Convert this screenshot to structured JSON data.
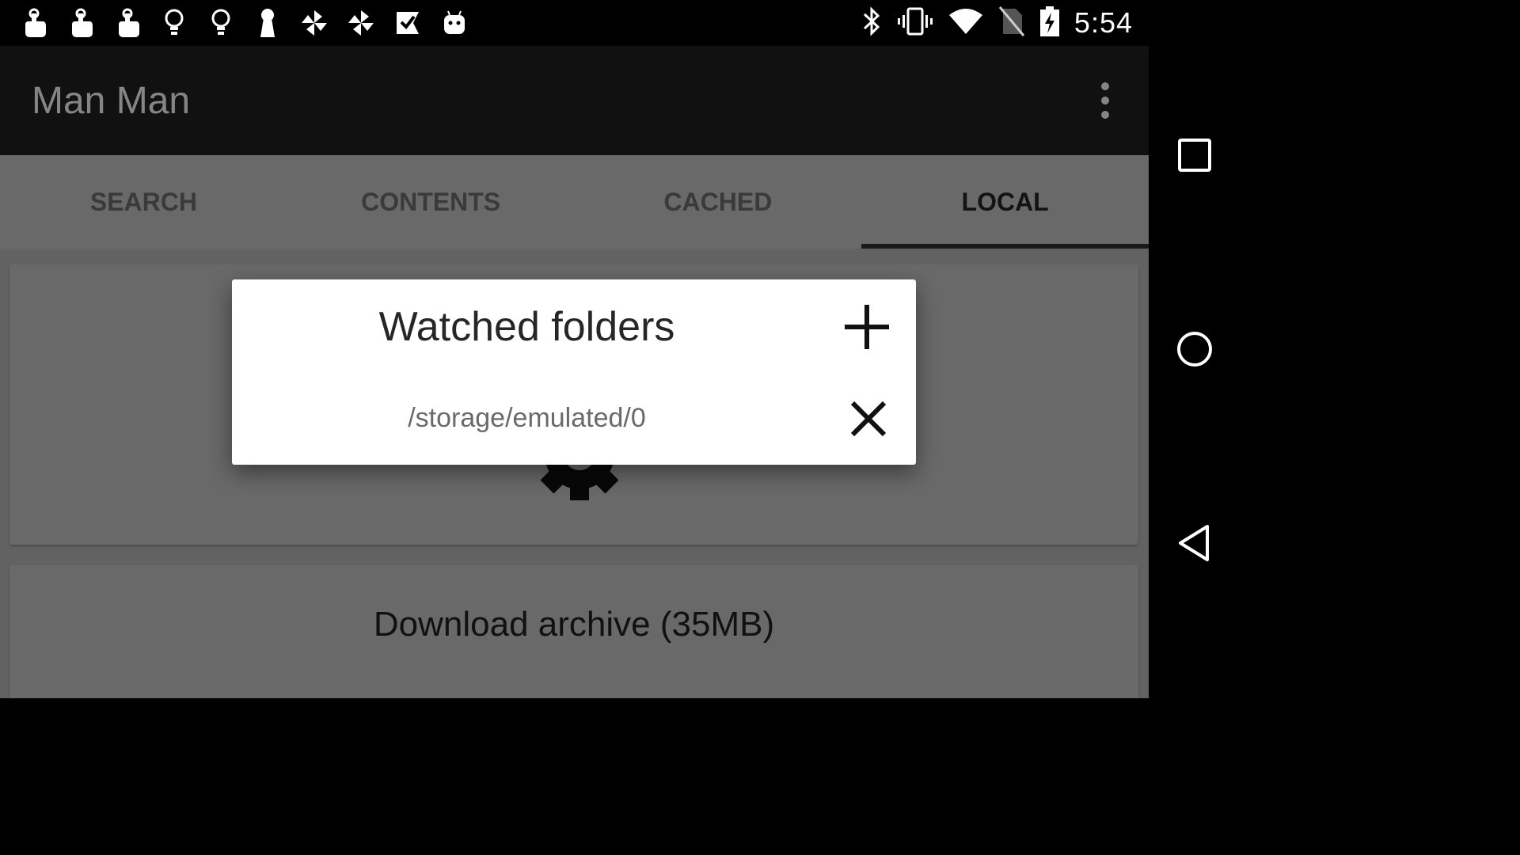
{
  "status_bar": {
    "notification_icons": [
      "hand-pointer-icon",
      "hand-pointer-icon",
      "hand-pointer-icon",
      "lightbulb-icon",
      "lightbulb-icon",
      "keyhole-icon",
      "pinwheel-icon",
      "pinwheel-icon",
      "check-flag-icon",
      "android-robot-icon"
    ],
    "system_icons": [
      "bluetooth-icon",
      "vibrate-icon",
      "wifi-icon",
      "no-sim-icon",
      "battery-charging-icon"
    ],
    "time": "5:54"
  },
  "app_bar": {
    "title": "Man Man"
  },
  "tabs": [
    {
      "label": "SEARCH",
      "active": false
    },
    {
      "label": "CONTENTS",
      "active": false
    },
    {
      "label": "CACHED",
      "active": false
    },
    {
      "label": "LOCAL",
      "active": true
    }
  ],
  "background": {
    "download_label": "Download archive (35MB)"
  },
  "dialog": {
    "title": "Watched folders",
    "folders": [
      "/storage/emulated/0"
    ]
  },
  "colors": {
    "status_bar": "#000000",
    "app_bar": "#212121",
    "tab_bar": "#c9c9c9",
    "dialog_bg": "#ffffff",
    "scrim": "rgba(0,0,0,0.48)"
  }
}
